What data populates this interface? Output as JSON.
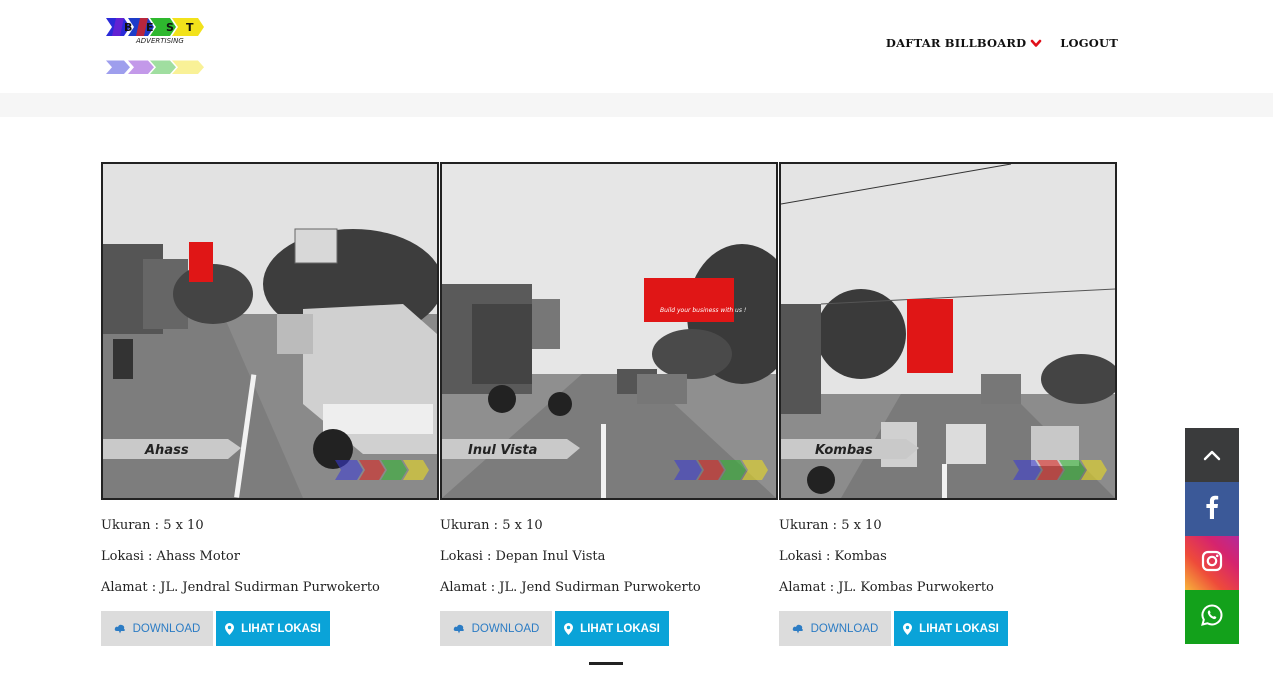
{
  "header": {
    "logo_text": "BEST",
    "logo_subtext": "ADVERTISING",
    "nav": [
      {
        "label": "DAFTAR BILLBOARD"
      },
      {
        "label": "LOGOUT"
      }
    ]
  },
  "cards": [
    {
      "photo_caption": "Ahass",
      "ukuran": "Ukuran : 5 x 10",
      "lokasi": "Lokasi   : Ahass Motor",
      "alamat": "Alamat  : JL. Jendral Sudirman Purwokerto",
      "download_label": "DOWNLOAD",
      "lihat_label": "LIHAT LOKASI"
    },
    {
      "photo_caption": "Inul Vista",
      "ukuran": "Ukuran : 5 x 10",
      "lokasi": "Lokasi   : Depan Inul Vista",
      "alamat": "Alamat  : JL. Jend Sudirman Purwokerto",
      "download_label": "DOWNLOAD",
      "lihat_label": "LIHAT LOKASI"
    },
    {
      "photo_caption": "Kombas",
      "ukuran": "Ukuran : 5 x 10",
      "lokasi": "Lokasi   : Kombas",
      "alamat": "Alamat  : JL. Kombas Purwokerto",
      "download_label": "DOWNLOAD",
      "lihat_label": "LIHAT LOKASI"
    }
  ],
  "social": [
    {
      "icon": "chevron-up-icon"
    },
    {
      "icon": "facebook-icon",
      "color": "#3b5998"
    },
    {
      "icon": "instagram-icon"
    },
    {
      "icon": "whatsapp-icon",
      "color": "#13a11b"
    }
  ],
  "colors": {
    "accent": "#0aa3d8",
    "chevron": "#e0101a"
  }
}
